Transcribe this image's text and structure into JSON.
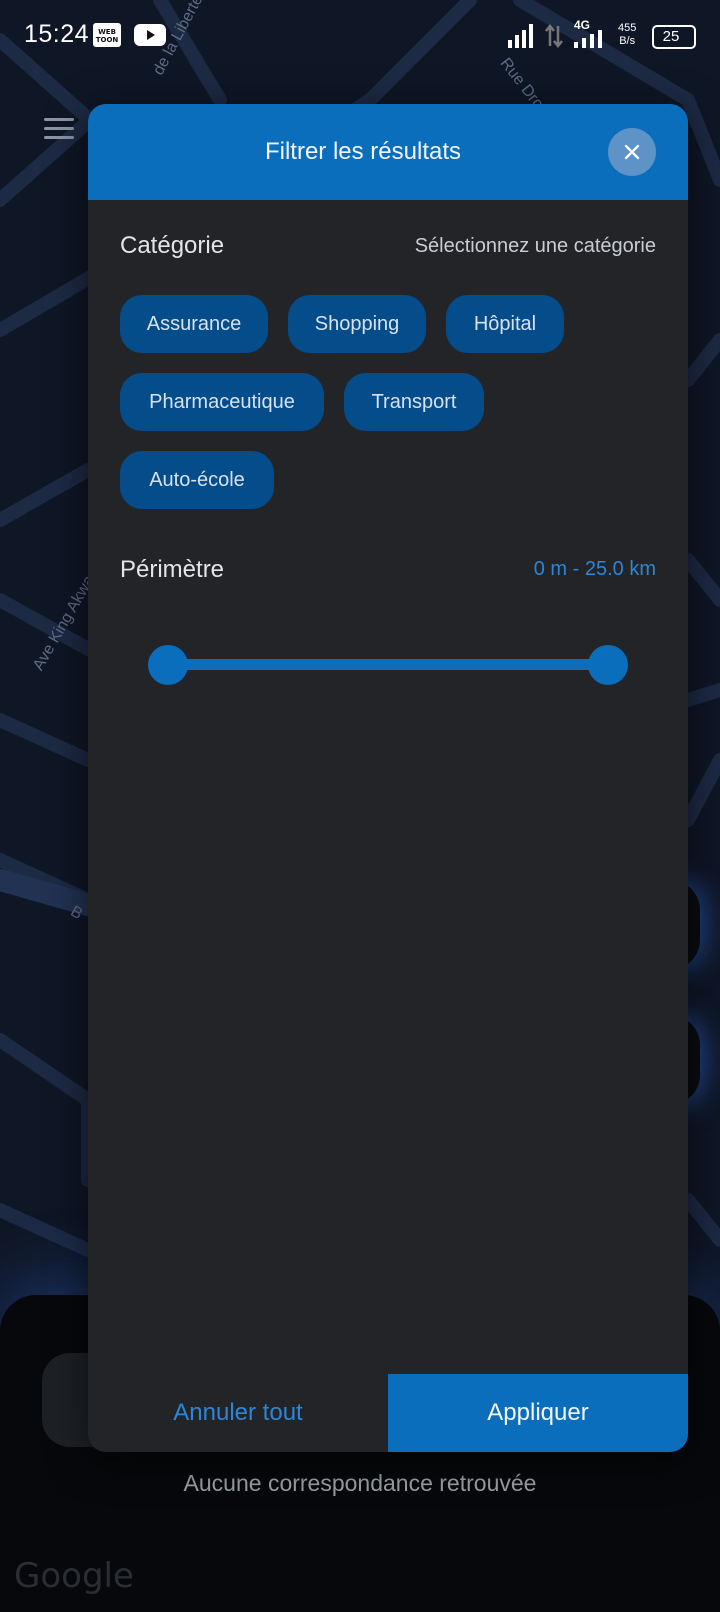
{
  "status_bar": {
    "time": "15:24",
    "network": "4G",
    "speed": "455",
    "speed_unit": "B/s",
    "battery": "25"
  },
  "map": {
    "streets": [
      "de la Liberté",
      "Rue Dro",
      "Ave King Akwa",
      "B"
    ],
    "attribution": "Google"
  },
  "filter_modal": {
    "title": "Filtrer les résultats",
    "category_label": "Catégorie",
    "category_placeholder": "Sélectionnez une catégorie",
    "categories": [
      "Assurance",
      "Shopping",
      "Hôpital",
      "Pharmaceutique",
      "Transport",
      "Auto-école"
    ],
    "perimeter_label": "Périmètre",
    "perimeter_value": "0 m - 25.0 km",
    "perimeter_range": {
      "min_km": 0,
      "max_km": 25.0,
      "selected_min_fraction": 0,
      "selected_max_fraction": 1
    },
    "cancel_label": "Annuler tout",
    "apply_label": "Appliquer"
  },
  "results": {
    "empty_message": "Aucune correspondance retrouvée"
  },
  "colors": {
    "accent": "#0b6ebd",
    "chip_bg": "#044d8a",
    "modal_bg": "#222428",
    "map_bg": "#0f1626"
  }
}
